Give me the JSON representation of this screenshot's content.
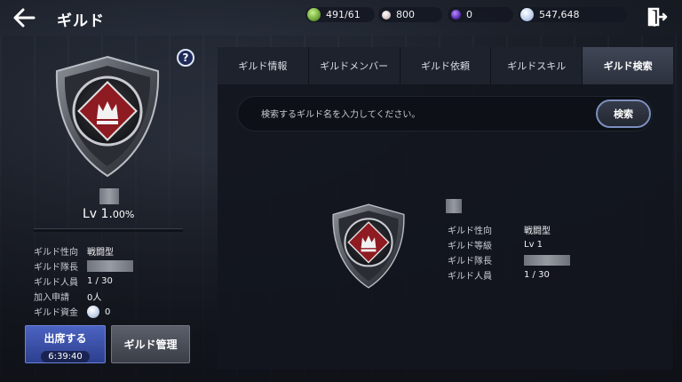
{
  "header": {
    "title": "ギルド",
    "back_icon": "back-arrow-icon",
    "exit_icon": "exit-door-icon"
  },
  "resources": [
    {
      "icon": "stamina-icon",
      "value": "491/61",
      "color": "#7fbf4a"
    },
    {
      "icon": "pearl-icon",
      "value": "800",
      "color": "#d8c9c9"
    },
    {
      "icon": "purple-gem-icon",
      "value": "0",
      "color": "#6b3fc4"
    },
    {
      "icon": "silver-coin-icon",
      "value": "547,648",
      "color": "#b9cbe6"
    }
  ],
  "left_panel": {
    "help": "?",
    "level_label": "Lv 1.",
    "level_pct": "00%",
    "exp_fraction": 0.0,
    "info": [
      {
        "key": "ギルド性向",
        "value": "戦闘型"
      },
      {
        "key": "ギルド隊長",
        "value": ""
      },
      {
        "key": "ギルド人員",
        "value": "1 / 30"
      },
      {
        "key": "加入申請",
        "value": "0人"
      },
      {
        "key": "ギルド資金",
        "value": "0"
      }
    ],
    "attend_button": {
      "label": "出席する",
      "timer": "6:39:40"
    },
    "manage_button": "ギルド管理"
  },
  "tabs": [
    {
      "label": "ギルド情報",
      "active": false
    },
    {
      "label": "ギルドメンバー",
      "active": false
    },
    {
      "label": "ギルド依頼",
      "active": false
    },
    {
      "label": "ギルドスキル",
      "active": false
    },
    {
      "label": "ギルド検索",
      "active": true
    }
  ],
  "search": {
    "placeholder": "検索するギルド名を入力してください。",
    "button": "検索"
  },
  "result": {
    "info": [
      {
        "key": "ギルド性向",
        "value": "戦闘型"
      },
      {
        "key": "ギルド等級",
        "value": "Lv 1"
      },
      {
        "key": "ギルド隊長",
        "value": ""
      },
      {
        "key": "ギルド人員",
        "value": "1 / 30"
      }
    ]
  },
  "colors": {
    "accent_blue": "#3b52a8",
    "emblem_red": "#8e1a22",
    "panel_bg": "#12161e"
  }
}
